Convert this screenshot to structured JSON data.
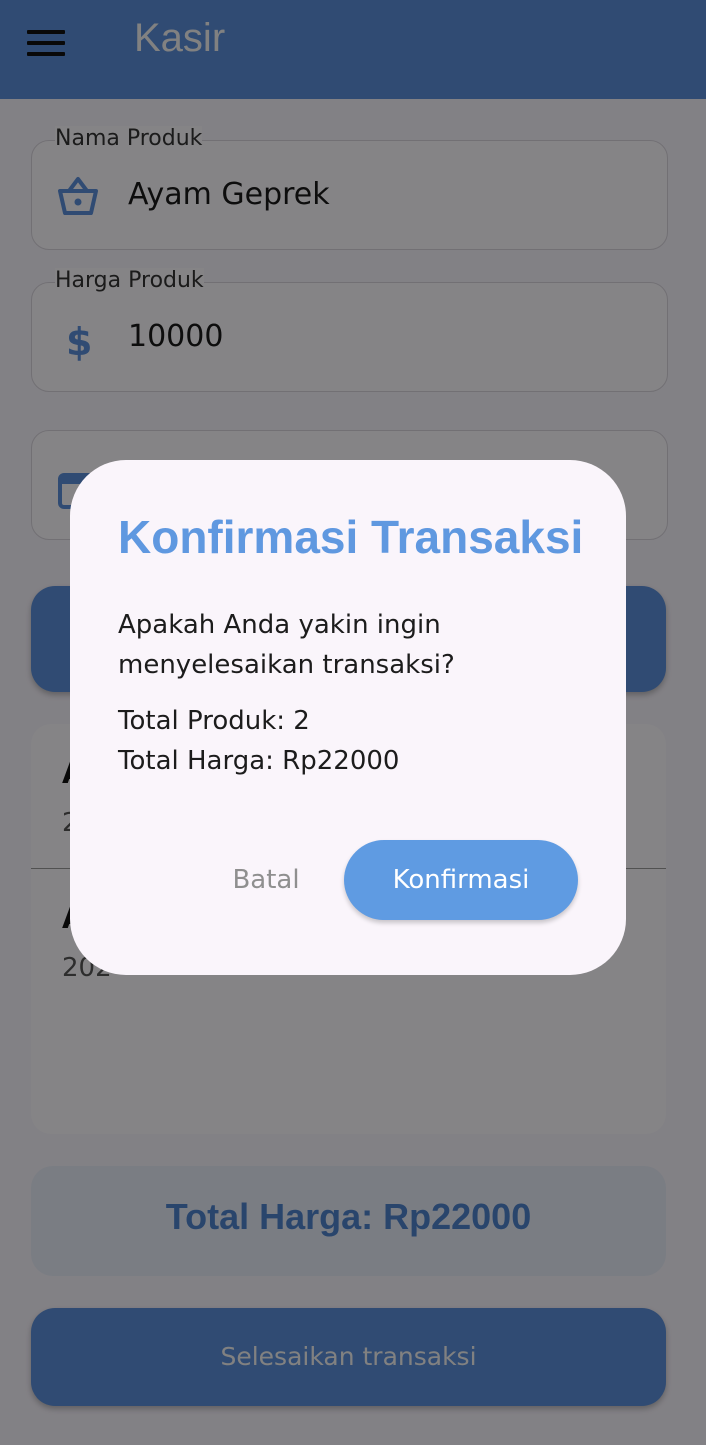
{
  "appbar": {
    "title": "Kasir"
  },
  "form": {
    "product_name": {
      "label": "Nama Produk",
      "value": "Ayam Geprek",
      "icon": "basket-icon"
    },
    "product_price": {
      "label": "Harga Produk",
      "value": "10000",
      "icon": "dollar-icon"
    },
    "date_field": {
      "icon": "calendar-icon"
    }
  },
  "list": {
    "items": [
      {
        "title": "A",
        "subtitle": "2"
      },
      {
        "title": "A",
        "subtitle": "202"
      }
    ]
  },
  "total": {
    "text": "Total Harga: Rp22000"
  },
  "finish_button": {
    "label": "Selesaikan transaksi"
  },
  "dialog": {
    "title": "Konfirmasi Transaksi",
    "message": "Apakah Anda yakin ingin menyelesaikan transaksi?",
    "total_products": "Total Produk: 2",
    "total_price": "Total Harga: Rp22000",
    "cancel_label": "Batal",
    "confirm_label": "Konfirmasi"
  },
  "colors": {
    "primary": "#5b8fd9",
    "dialog_accent": "#5f9be2"
  }
}
